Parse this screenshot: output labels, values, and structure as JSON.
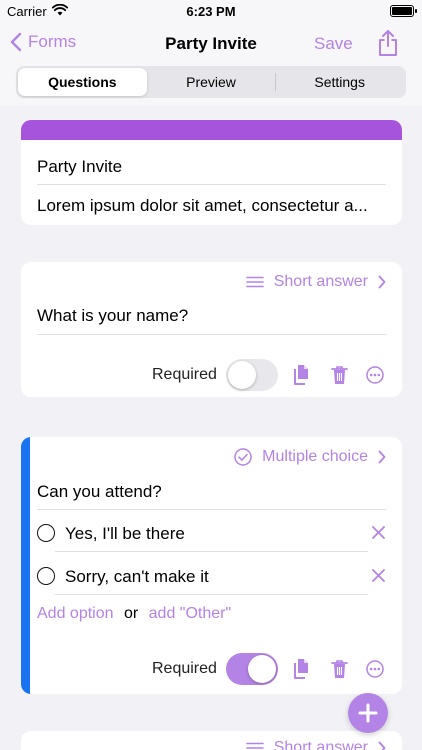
{
  "status_bar": {
    "carrier": "Carrier",
    "time": "6:23 PM"
  },
  "nav": {
    "back_label": "Forms",
    "title": "Party Invite",
    "save_label": "Save"
  },
  "segments": [
    {
      "label": "Questions",
      "active": true
    },
    {
      "label": "Preview",
      "active": false
    },
    {
      "label": "Settings",
      "active": false
    }
  ],
  "form_header": {
    "title": "Party Invite",
    "description": "Lorem ipsum dolor sit amet, consectetur a..."
  },
  "questions": [
    {
      "type_label": "Short answer",
      "type_icon": "short-answer-icon",
      "question": "What is your name?",
      "required_label": "Required",
      "required": false
    },
    {
      "type_label": "Multiple choice",
      "type_icon": "multiple-choice-icon",
      "question": "Can you attend?",
      "options": [
        "Yes,  I'll be there",
        "Sorry, can't make it"
      ],
      "add_option_label": "Add option",
      "or_label": "or",
      "add_other_label": "add \"Other\"",
      "required_label": "Required",
      "required": true
    },
    {
      "type_label": "Short answer",
      "type_icon": "short-answer-icon"
    }
  ],
  "colors": {
    "accent": "#b383e6",
    "header_bar": "#a754dd",
    "selected_card_edge": "#1a73f0"
  }
}
